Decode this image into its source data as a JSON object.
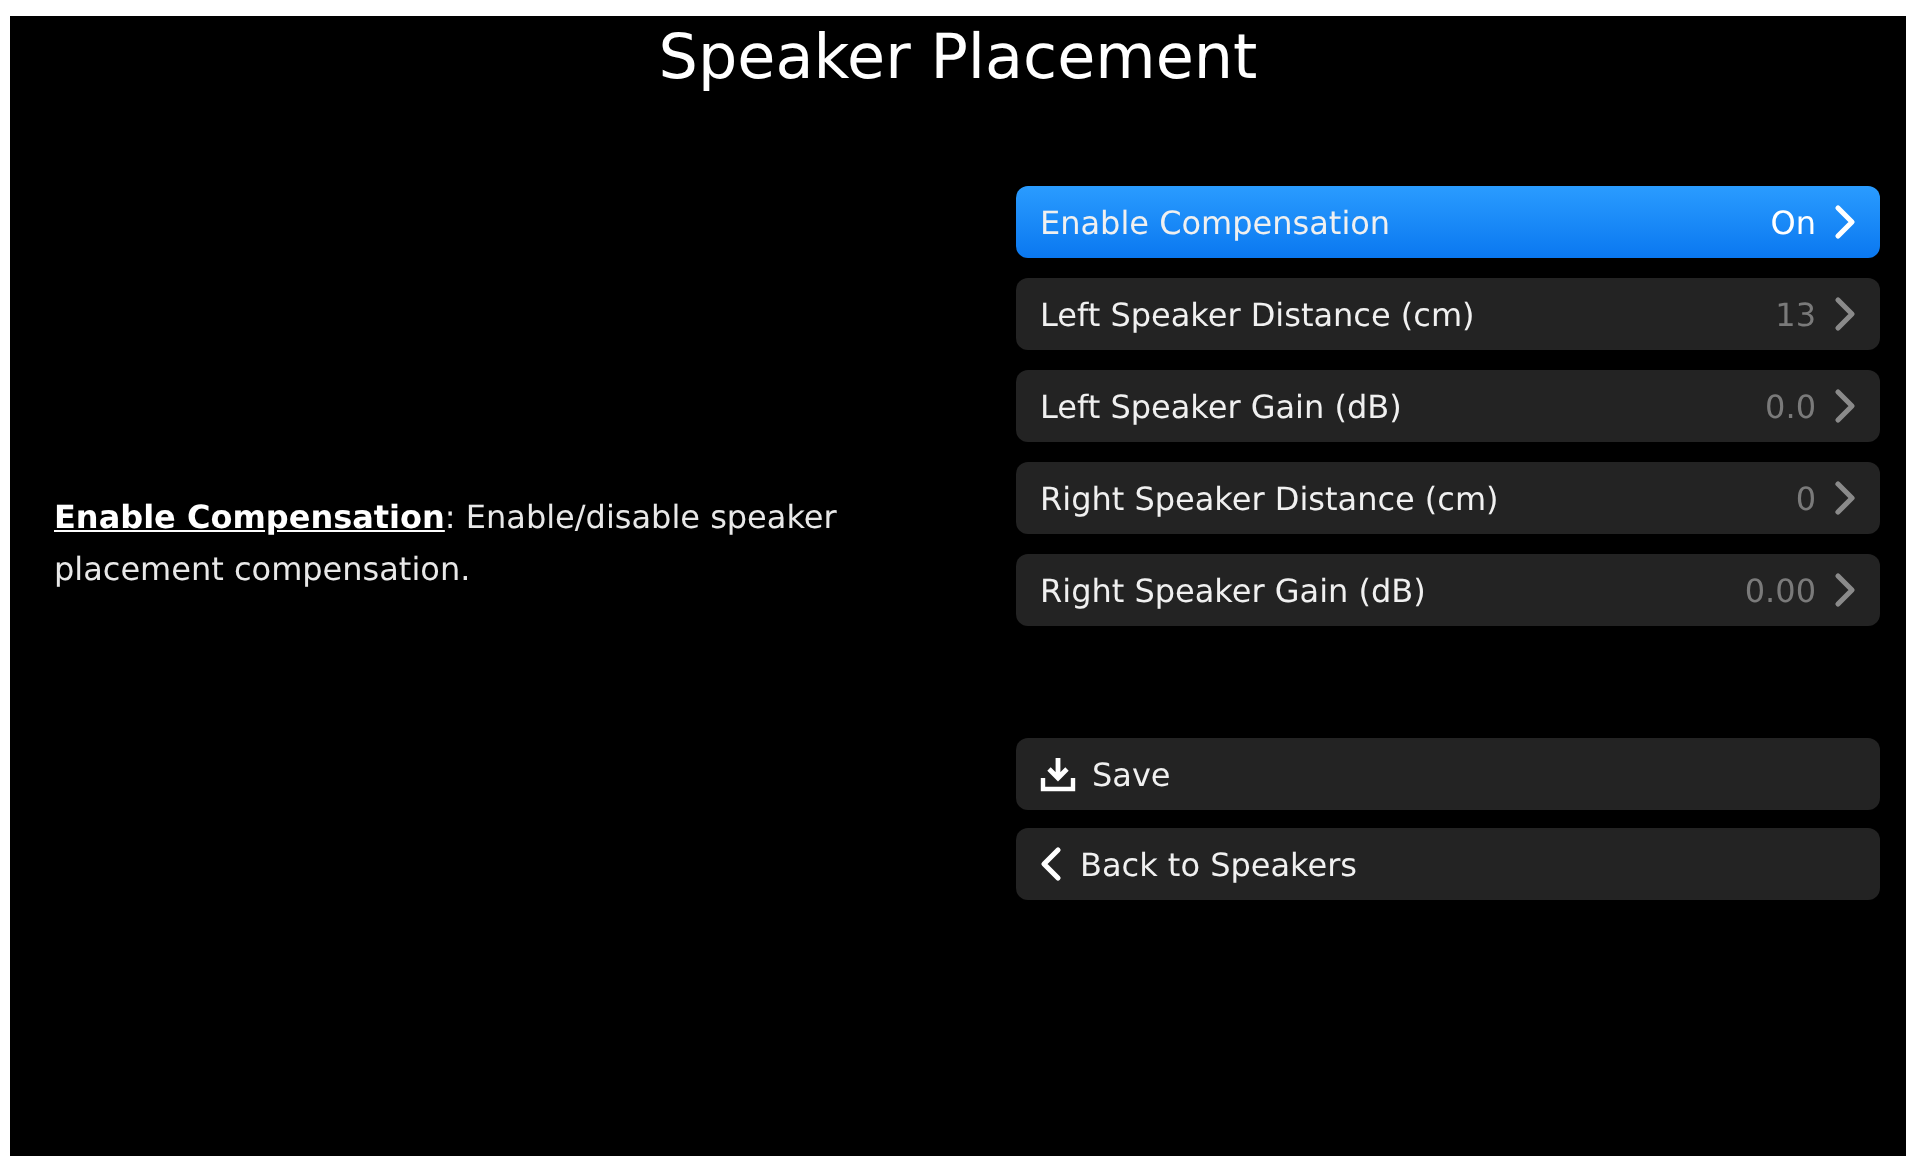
{
  "title": "Speaker Placement",
  "description": "**Enable Compensation**: Enable/disable speaker placement compensation.",
  "settings": [
    {
      "label": "Enable Compensation",
      "value": "On",
      "selected": true
    },
    {
      "label": "Left Speaker Distance (cm)",
      "value": "13",
      "selected": false
    },
    {
      "label": "Left Speaker Gain (dB)",
      "value": "0.0",
      "selected": false
    },
    {
      "label": "Right Speaker Distance (cm)",
      "value": "0",
      "selected": false
    },
    {
      "label": "Right Speaker Gain (dB)",
      "value": "0.00",
      "selected": false
    }
  ],
  "actions": [
    {
      "kind": "save",
      "label": "Save"
    },
    {
      "kind": "back",
      "label": "Back to Speakers"
    }
  ]
}
